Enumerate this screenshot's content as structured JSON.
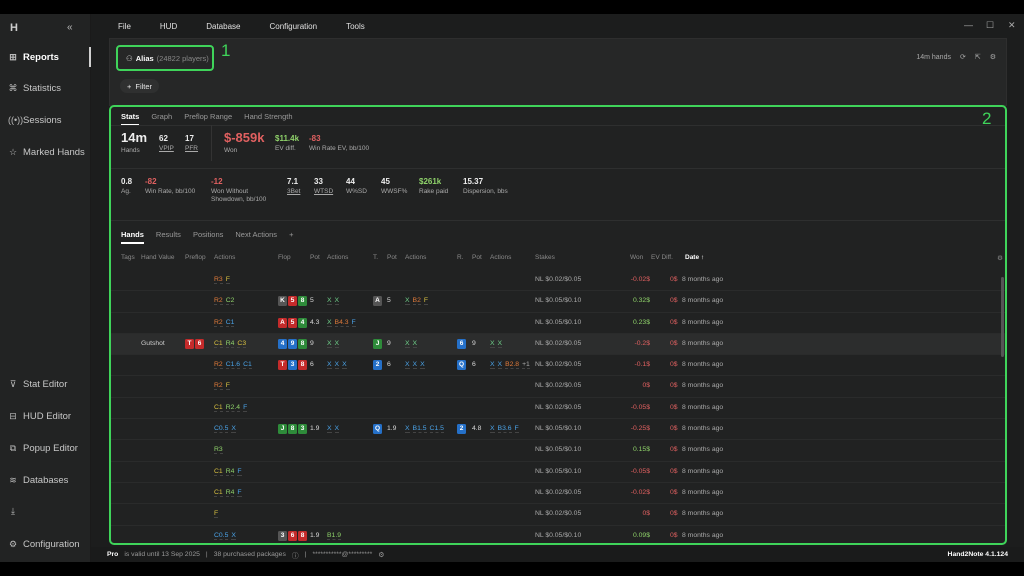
{
  "sidebar": {
    "logo": "H",
    "collapse": "«",
    "items_top": [
      {
        "label": "Reports",
        "icon": "report-icon"
      },
      {
        "label": "Statistics",
        "icon": "statistics-icon"
      },
      {
        "label": "Sessions",
        "icon": "sessions-icon"
      },
      {
        "label": "Marked Hands",
        "icon": "star-icon"
      }
    ],
    "items_bottom": [
      {
        "label": "Stat Editor",
        "icon": "filter-icon"
      },
      {
        "label": "HUD Editor",
        "icon": "hud-icon"
      },
      {
        "label": "Popup Editor",
        "icon": "popup-icon"
      },
      {
        "label": "Databases",
        "icon": "database-icon"
      },
      {
        "label": "",
        "icon": "download-icon"
      },
      {
        "label": "Configuration",
        "icon": "gear-icon"
      }
    ]
  },
  "menu": [
    "File",
    "HUD",
    "Database",
    "Configuration",
    "Tools"
  ],
  "window": {
    "min": "—",
    "max": "☐",
    "close": "✕"
  },
  "alias": {
    "name": "Alias",
    "count": "(24822 players)"
  },
  "annotations": {
    "one": "1",
    "two": "2"
  },
  "filter_label": "Filter",
  "hands_count": "14m hands",
  "stat_tabs": [
    "Stats",
    "Graph",
    "Preflop Range",
    "Hand Strength"
  ],
  "stats_row1": [
    {
      "value": "14m",
      "label": "Hands",
      "big": true
    },
    {
      "value": "62",
      "label": "VPIP"
    },
    {
      "value": "17",
      "label": "PFR"
    },
    {
      "value": "$-859k",
      "label": "Won",
      "big": true
    },
    {
      "value": "$11.4k",
      "label": "EV diff."
    },
    {
      "value": "-83",
      "label": "Win Rate EV, bb/100"
    }
  ],
  "stats_row2": [
    {
      "value": "0.8",
      "label": "Ag."
    },
    {
      "value": "-82",
      "label": "Win Rate, bb/100"
    },
    {
      "value": "-12",
      "label": "Won Without Showdown, bb/100"
    },
    {
      "value": "7.1",
      "label": "3Bet"
    },
    {
      "value": "33",
      "label": "WTSD"
    },
    {
      "value": "44",
      "label": "W%SD"
    },
    {
      "value": "45",
      "label": "WWSF%"
    },
    {
      "value": "$261k",
      "label": "Rake paid"
    },
    {
      "value": "15.37",
      "label": "Dispersion, bbs"
    }
  ],
  "table_tabs": [
    "Hands",
    "Results",
    "Positions",
    "Next Actions",
    "+"
  ],
  "columns": [
    "Tags",
    "Hand Value",
    "Preflop",
    "Actions",
    "Flop",
    "Pot",
    "Actions",
    "T.",
    "Pot",
    "Actions",
    "R.",
    "Pot",
    "Actions",
    "Stakes",
    "Won",
    "EV Diff.",
    "Date ↑"
  ],
  "rows": [
    {
      "hv": "",
      "hc": [],
      "pre": [
        [
          "R3",
          "r"
        ],
        [
          "F",
          "f"
        ]
      ],
      "flop": [],
      "fpot": "",
      "fact": [],
      "turn": [],
      "tpot": "",
      "tact": [],
      "river": [],
      "rpot": "",
      "ract": [],
      "stakes": "NL $0.02/$0.05",
      "won": "-0.02$",
      "ev": "0$",
      "date": "8 months ago"
    },
    {
      "hv": "",
      "hc": [],
      "pre": [
        [
          "R2",
          "r"
        ],
        [
          "C2",
          "g"
        ]
      ],
      "flop": [
        [
          "K",
          "s"
        ],
        [
          "5",
          "h"
        ],
        [
          "8",
          "c"
        ]
      ],
      "fpot": "5",
      "fact": [
        [
          "X",
          "x"
        ],
        [
          "X",
          "x"
        ]
      ],
      "turn": [
        [
          "A",
          "s"
        ]
      ],
      "tpot": "5",
      "tact": [
        [
          "X",
          "x"
        ],
        [
          "B2",
          "r"
        ],
        [
          "F",
          "f"
        ]
      ],
      "river": [],
      "rpot": "",
      "ract": [],
      "stakes": "NL $0.05/$0.10",
      "won": "0.32$",
      "ev": "0$",
      "date": "8 months ago"
    },
    {
      "hv": "",
      "hc": [],
      "pre": [
        [
          "R2",
          "r"
        ],
        [
          "C1",
          "c"
        ]
      ],
      "flop": [
        [
          "A",
          "h"
        ],
        [
          "5",
          "h"
        ],
        [
          "4",
          "c"
        ]
      ],
      "fpot": "4.3",
      "fact": [
        [
          "X",
          "x"
        ],
        [
          "B4.3",
          "r"
        ],
        [
          "F",
          "c"
        ]
      ],
      "turn": [],
      "tpot": "",
      "tact": [],
      "river": [],
      "rpot": "",
      "ract": [],
      "stakes": "NL $0.05/$0.10",
      "won": "0.23$",
      "ev": "0$",
      "date": "8 months ago"
    },
    {
      "hv": "Gutshot",
      "hc": [
        [
          "T",
          "h"
        ],
        [
          "6",
          "h"
        ]
      ],
      "pre": [
        [
          "C1",
          "y"
        ],
        [
          "R4",
          "g"
        ],
        [
          "C3",
          "y"
        ]
      ],
      "flop": [
        [
          "4",
          "d"
        ],
        [
          "9",
          "d"
        ],
        [
          "8",
          "c"
        ]
      ],
      "fpot": "9",
      "fact": [
        [
          "X",
          "x"
        ],
        [
          "X",
          "x"
        ]
      ],
      "turn": [
        [
          "J",
          "c"
        ]
      ],
      "tpot": "9",
      "tact": [
        [
          "X",
          "x"
        ],
        [
          "X",
          "x"
        ]
      ],
      "river": [
        [
          "6",
          "d"
        ]
      ],
      "rpot": "9",
      "ract": [
        [
          "X",
          "x"
        ],
        [
          "X",
          "x"
        ]
      ],
      "stakes": "NL $0.02/$0.05",
      "won": "-0.2$",
      "ev": "0$",
      "date": "8 months ago"
    },
    {
      "hv": "",
      "hc": [],
      "pre": [
        [
          "R2",
          "r"
        ],
        [
          "C1.6",
          "c"
        ],
        [
          "C1",
          "c"
        ]
      ],
      "flop": [
        [
          "T",
          "h"
        ],
        [
          "3",
          "d"
        ],
        [
          "8",
          "h"
        ]
      ],
      "fpot": "6",
      "fact": [
        [
          "X",
          "c"
        ],
        [
          "X",
          "c"
        ],
        [
          "X",
          "c"
        ]
      ],
      "turn": [
        [
          "2",
          "d"
        ]
      ],
      "tpot": "6",
      "tact": [
        [
          "X",
          "c"
        ],
        [
          "X",
          "c"
        ],
        [
          "X",
          "c"
        ]
      ],
      "river": [
        [
          "Q",
          "d"
        ]
      ],
      "rpot": "6",
      "ract": [
        [
          "X",
          "c"
        ],
        [
          "X",
          "c"
        ],
        [
          "B2.8",
          "r"
        ],
        [
          "+1",
          "z"
        ]
      ],
      "stakes": "NL $0.02/$0.05",
      "won": "-0.1$",
      "ev": "0$",
      "date": "8 months ago"
    },
    {
      "hv": "",
      "hc": [],
      "pre": [
        [
          "R2",
          "r"
        ],
        [
          "F",
          "f"
        ]
      ],
      "flop": [],
      "fpot": "",
      "fact": [],
      "turn": [],
      "tpot": "",
      "tact": [],
      "river": [],
      "rpot": "",
      "ract": [],
      "stakes": "NL $0.02/$0.05",
      "won": "0$",
      "ev": "0$",
      "date": "8 months ago"
    },
    {
      "hv": "",
      "hc": [],
      "pre": [
        [
          "C1",
          "y"
        ],
        [
          "R2.4",
          "g"
        ],
        [
          "F",
          "c"
        ]
      ],
      "flop": [],
      "fpot": "",
      "fact": [],
      "turn": [],
      "tpot": "",
      "tact": [],
      "river": [],
      "rpot": "",
      "ract": [],
      "stakes": "NL $0.02/$0.05",
      "won": "-0.05$",
      "ev": "0$",
      "date": "8 months ago"
    },
    {
      "hv": "",
      "hc": [],
      "pre": [
        [
          "C0.5",
          "c"
        ],
        [
          "X",
          "c"
        ]
      ],
      "flop": [
        [
          "J",
          "c"
        ],
        [
          "8",
          "c"
        ],
        [
          "3",
          "c"
        ]
      ],
      "fpot": "1.9",
      "fact": [
        [
          "X",
          "c"
        ],
        [
          "X",
          "c"
        ]
      ],
      "turn": [
        [
          "Q",
          "d"
        ]
      ],
      "tpot": "1.9",
      "tact": [
        [
          "X",
          "c"
        ],
        [
          "B1.5",
          "c"
        ],
        [
          "C1.5",
          "c"
        ]
      ],
      "river": [
        [
          "2",
          "d"
        ]
      ],
      "rpot": "4.8",
      "ract": [
        [
          "X",
          "c"
        ],
        [
          "B3.6",
          "c"
        ],
        [
          "F",
          "c"
        ]
      ],
      "stakes": "NL $0.05/$0.10",
      "won": "-0.25$",
      "ev": "0$",
      "date": "8 months ago"
    },
    {
      "hv": "",
      "hc": [],
      "pre": [
        [
          "R3",
          "g"
        ]
      ],
      "flop": [],
      "fpot": "",
      "fact": [],
      "turn": [],
      "tpot": "",
      "tact": [],
      "river": [],
      "rpot": "",
      "ract": [],
      "stakes": "NL $0.05/$0.10",
      "won": "0.15$",
      "ev": "0$",
      "date": "8 months ago"
    },
    {
      "hv": "",
      "hc": [],
      "pre": [
        [
          "C1",
          "y"
        ],
        [
          "R4",
          "g"
        ],
        [
          "F",
          "c"
        ]
      ],
      "flop": [],
      "fpot": "",
      "fact": [],
      "turn": [],
      "tpot": "",
      "tact": [],
      "river": [],
      "rpot": "",
      "ract": [],
      "stakes": "NL $0.05/$0.10",
      "won": "-0.05$",
      "ev": "0$",
      "date": "8 months ago"
    },
    {
      "hv": "",
      "hc": [],
      "pre": [
        [
          "C1",
          "y"
        ],
        [
          "R4",
          "g"
        ],
        [
          "F",
          "c"
        ]
      ],
      "flop": [],
      "fpot": "",
      "fact": [],
      "turn": [],
      "tpot": "",
      "tact": [],
      "river": [],
      "rpot": "",
      "ract": [],
      "stakes": "NL $0.02/$0.05",
      "won": "-0.02$",
      "ev": "0$",
      "date": "8 months ago"
    },
    {
      "hv": "",
      "hc": [],
      "pre": [
        [
          "F",
          "y"
        ]
      ],
      "flop": [],
      "fpot": "",
      "fact": [],
      "turn": [],
      "tpot": "",
      "tact": [],
      "river": [],
      "rpot": "",
      "ract": [],
      "stakes": "NL $0.02/$0.05",
      "won": "0$",
      "ev": "0$",
      "date": "8 months ago"
    },
    {
      "hv": "",
      "hc": [],
      "pre": [
        [
          "C0.5",
          "c"
        ],
        [
          "X",
          "c"
        ]
      ],
      "flop": [
        [
          "3",
          "s"
        ],
        [
          "6",
          "h"
        ],
        [
          "8",
          "h"
        ]
      ],
      "fpot": "1.9",
      "fact": [
        [
          "B1.9",
          "g"
        ]
      ],
      "turn": [],
      "tpot": "",
      "tact": [],
      "river": [],
      "rpot": "",
      "ract": [],
      "stakes": "NL $0.05/$0.10",
      "won": "0.09$",
      "ev": "0$",
      "date": "8 months ago"
    }
  ],
  "status": {
    "pro": "Pro",
    "valid": "is valid until 13 Sep 2025",
    "packages": "38 purchased packages",
    "account": "***********@*********",
    "version": "Hand2Note 4.1.124"
  }
}
